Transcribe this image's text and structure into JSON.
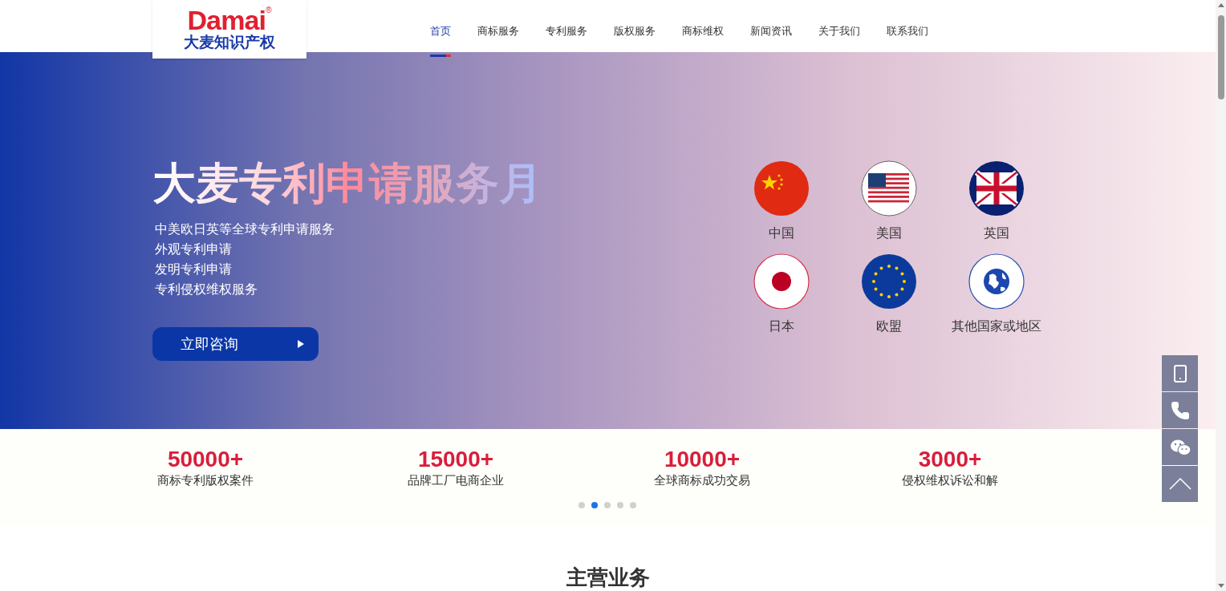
{
  "logo": {
    "brand": "Damai",
    "mark": "®",
    "tagline": "大麦知识产权"
  },
  "nav": [
    {
      "label": "首页",
      "selected": true
    },
    {
      "label": "商标服务",
      "selected": false
    },
    {
      "label": "专利服务",
      "selected": false
    },
    {
      "label": "版权服务",
      "selected": false
    },
    {
      "label": "商标维权",
      "selected": false
    },
    {
      "label": "新闻资讯",
      "selected": false
    },
    {
      "label": "关于我们",
      "selected": false
    },
    {
      "label": "联系我们",
      "selected": false
    }
  ],
  "hero": {
    "title": "大麦专利申请服务月",
    "lines": [
      "中美欧日英等全球专利申请服务",
      "外观专利申请",
      "发明专利申请",
      "专利侵权维权服务"
    ],
    "button": "立即咨询",
    "regions": [
      {
        "label": "中国",
        "kind": "cn"
      },
      {
        "label": "美国",
        "kind": "us"
      },
      {
        "label": "英国",
        "kind": "uk"
      },
      {
        "label": "日本",
        "kind": "jp"
      },
      {
        "label": "欧盟",
        "kind": "eu"
      },
      {
        "label": "其他国家或地区",
        "kind": "globe"
      }
    ]
  },
  "stats": [
    {
      "value": "50000+",
      "label": "商标专利版权案件"
    },
    {
      "value": "15000+",
      "label": "品牌工厂电商企业"
    },
    {
      "value": "10000+",
      "label": "全球商标成功交易"
    },
    {
      "value": "3000+",
      "label": "侵权维权诉讼和解"
    }
  ],
  "carousel_dots": [
    {
      "selected": false
    },
    {
      "selected": true
    },
    {
      "selected": false
    },
    {
      "selected": false
    },
    {
      "selected": false
    }
  ],
  "section_title": "主营业务",
  "side_tools": [
    {
      "kind": "mobile"
    },
    {
      "kind": "phone"
    },
    {
      "kind": "wechat"
    },
    {
      "kind": "top"
    }
  ]
}
